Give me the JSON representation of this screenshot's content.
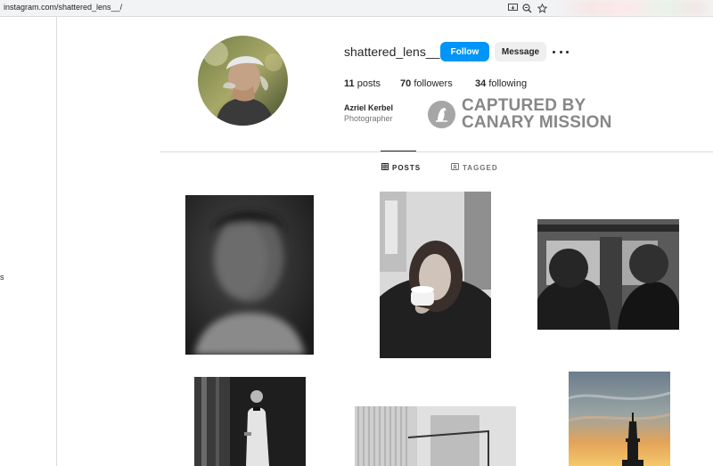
{
  "browser": {
    "url": "instagram.com/shattered_lens__/"
  },
  "sidebar": {
    "fragment_text": "s"
  },
  "profile": {
    "username": "shattered_lens__",
    "follow_label": "Follow",
    "message_label": "Message",
    "stats": {
      "posts_count": "11",
      "posts_label": "posts",
      "followers_count": "70",
      "followers_label": "followers",
      "following_count": "34",
      "following_label": "following"
    },
    "full_name": "Azriel Kerbel",
    "bio": "Photographer"
  },
  "watermark": {
    "line1": "CAPTURED BY",
    "line2": "CANARY MISSION"
  },
  "tabs": [
    {
      "label": "POSTS",
      "icon": "grid-icon",
      "active": true
    },
    {
      "label": "TAGGED",
      "icon": "tagged-icon",
      "active": false
    }
  ],
  "colors": {
    "follow_button": "#0095f6",
    "watermark": "#878787"
  }
}
